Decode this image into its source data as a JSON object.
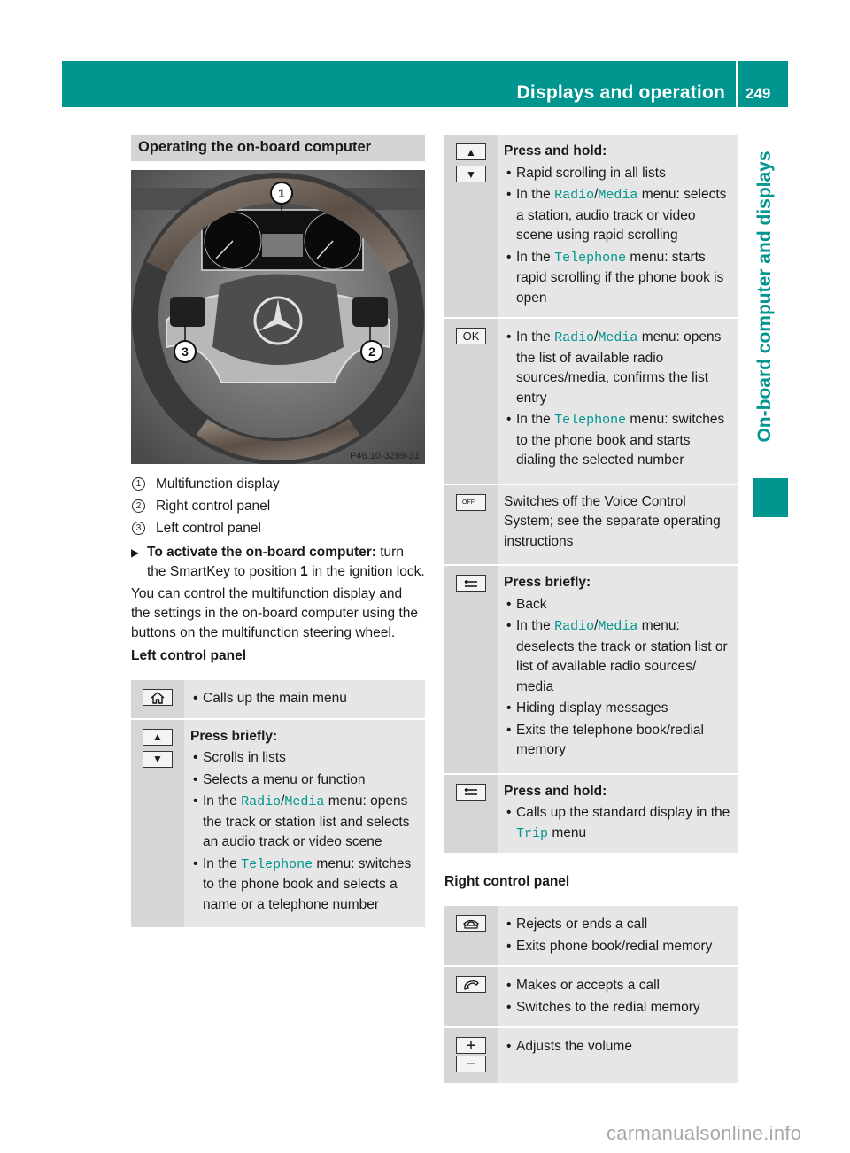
{
  "header": {
    "title": "Displays and operation",
    "page_number": "249",
    "side_tab": "On-board computer and displays",
    "accent_color": "#00968f"
  },
  "left": {
    "section_title": "Operating the on-board computer",
    "figure": {
      "caption_code": "P46.10-3299-31",
      "callouts": [
        "1",
        "2",
        "3"
      ]
    },
    "legend": [
      {
        "num": "1",
        "label": "Multifunction display"
      },
      {
        "num": "2",
        "label": "Right control panel"
      },
      {
        "num": "3",
        "label": "Left control panel"
      }
    ],
    "instruction": {
      "bold": "To activate the on-board computer:",
      "rest_1": " turn the SmartKey to position ",
      "position": "1",
      "rest_2": " in the ignition lock."
    },
    "paragraph": "You can control the multifunction display and the settings in the on-board computer using the buttons on the multifunction steering wheel.",
    "table_title": "Left control panel",
    "rows": [
      {
        "icon": "home-icon",
        "bullets": [
          "Calls up the main menu"
        ]
      },
      {
        "icon": "up-down-arrow-icon",
        "heading": "Press briefly:",
        "b1": "Scrolls in lists",
        "b2": "Selects a menu or function",
        "b3_pre": "In the ",
        "b3_radio": "Radio",
        "b3_slash": "/",
        "b3_media": "Media",
        "b3_post": " menu: opens the track or station list and selects an audio track or video scene",
        "b4_pre": "In the ",
        "b4_tel": "Telephone",
        "b4_post": " menu: switches to the phone book and selects a name or a telephone number"
      }
    ]
  },
  "right": {
    "rows": [
      {
        "icon": "up-down-arrow-icon",
        "heading": "Press and hold:",
        "b1": "Rapid scrolling in all lists",
        "b2_pre": "In the ",
        "b2_radio": "Radio",
        "b2_slash": "/",
        "b2_media": "Media",
        "b2_post": " menu: selects a station, audio track or video scene using rapid scrolling",
        "b3_pre": "In the ",
        "b3_tel": "Telephone",
        "b3_post": " menu: starts rapid scrolling if the phone book is open"
      },
      {
        "icon": "ok-icon",
        "icon_text": "OK",
        "b1_pre": "In the ",
        "b1_radio": "Radio",
        "b1_slash": "/",
        "b1_media": "Media",
        "b1_post": " menu: opens the list of available radio sources/media, confirms the list entry",
        "b2_pre": "In the ",
        "b2_tel": "Telephone",
        "b2_post": " menu: switches to the phone book and starts dialing the selected number"
      },
      {
        "icon": "voice-off-icon",
        "icon_text": "OFF",
        "text": "Switches off the Voice Control System; see the separate operating instructions"
      },
      {
        "icon": "back-icon",
        "heading": "Press briefly:",
        "b1": "Back",
        "b2_pre": "In the ",
        "b2_radio": "Radio",
        "b2_slash": "/",
        "b2_media": "Media",
        "b2_post": " menu: deselects the track or station list or list of available radio sources/ media",
        "b3": "Hiding display messages",
        "b4": "Exits the telephone book/redial memory"
      },
      {
        "icon": "back-icon",
        "heading": "Press and hold:",
        "b1_pre": "Calls up the standard display in the ",
        "b1_trip": "Trip",
        "b1_post": " menu"
      }
    ],
    "table_title": "Right control panel",
    "rows2": [
      {
        "icon": "hang-up-icon",
        "b1": "Rejects or ends a call",
        "b2": "Exits phone book/redial memory"
      },
      {
        "icon": "phone-icon",
        "b1": "Makes or accepts a call",
        "b2": "Switches to the redial memory"
      },
      {
        "icon": "volume-plus-minus-icon",
        "plus": "+",
        "minus": "−",
        "b1": "Adjusts the volume"
      }
    ]
  },
  "watermark": "carmanualsonline.info",
  "bullet_char": "•"
}
